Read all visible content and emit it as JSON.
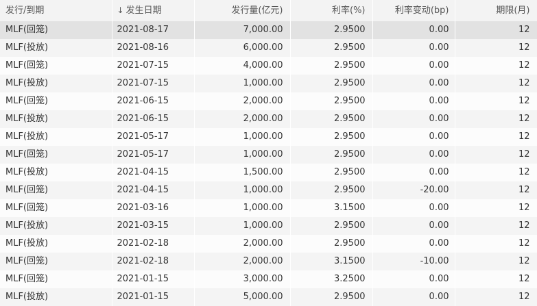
{
  "headers": {
    "type": "发行/到期",
    "sort_icon": "↓",
    "date": "发生日期",
    "amount": "发行量(亿元)",
    "rate": "利率(%)",
    "change": "利率变动(bp)",
    "term": "期限(月)"
  },
  "rows": [
    {
      "type": "MLF(回笼)",
      "date": "2021-08-17",
      "amount": "7,000.00",
      "rate": "2.9500",
      "change": "0.00",
      "term": "12"
    },
    {
      "type": "MLF(投放)",
      "date": "2021-08-16",
      "amount": "6,000.00",
      "rate": "2.9500",
      "change": "0.00",
      "term": "12"
    },
    {
      "type": "MLF(回笼)",
      "date": "2021-07-15",
      "amount": "4,000.00",
      "rate": "2.9500",
      "change": "0.00",
      "term": "12"
    },
    {
      "type": "MLF(投放)",
      "date": "2021-07-15",
      "amount": "1,000.00",
      "rate": "2.9500",
      "change": "0.00",
      "term": "12"
    },
    {
      "type": "MLF(回笼)",
      "date": "2021-06-15",
      "amount": "2,000.00",
      "rate": "2.9500",
      "change": "0.00",
      "term": "12"
    },
    {
      "type": "MLF(投放)",
      "date": "2021-06-15",
      "amount": "2,000.00",
      "rate": "2.9500",
      "change": "0.00",
      "term": "12"
    },
    {
      "type": "MLF(投放)",
      "date": "2021-05-17",
      "amount": "1,000.00",
      "rate": "2.9500",
      "change": "0.00",
      "term": "12"
    },
    {
      "type": "MLF(回笼)",
      "date": "2021-05-17",
      "amount": "1,000.00",
      "rate": "2.9500",
      "change": "0.00",
      "term": "12"
    },
    {
      "type": "MLF(投放)",
      "date": "2021-04-15",
      "amount": "1,500.00",
      "rate": "2.9500",
      "change": "0.00",
      "term": "12"
    },
    {
      "type": "MLF(回笼)",
      "date": "2021-04-15",
      "amount": "1,000.00",
      "rate": "2.9500",
      "change": "-20.00",
      "term": "12"
    },
    {
      "type": "MLF(回笼)",
      "date": "2021-03-16",
      "amount": "1,000.00",
      "rate": "3.1500",
      "change": "0.00",
      "term": "12"
    },
    {
      "type": "MLF(投放)",
      "date": "2021-03-15",
      "amount": "1,000.00",
      "rate": "2.9500",
      "change": "0.00",
      "term": "12"
    },
    {
      "type": "MLF(投放)",
      "date": "2021-02-18",
      "amount": "2,000.00",
      "rate": "2.9500",
      "change": "0.00",
      "term": "12"
    },
    {
      "type": "MLF(回笼)",
      "date": "2021-02-18",
      "amount": "2,000.00",
      "rate": "3.1500",
      "change": "-10.00",
      "term": "12"
    },
    {
      "type": "MLF(回笼)",
      "date": "2021-01-15",
      "amount": "3,000.00",
      "rate": "3.2500",
      "change": "0.00",
      "term": "12"
    },
    {
      "type": "MLF(投放)",
      "date": "2021-01-15",
      "amount": "5,000.00",
      "rate": "2.9500",
      "change": "0.00",
      "term": "12"
    }
  ],
  "selected_row_index": 0,
  "colors": {
    "header_bg": "#f3f3f3",
    "row_odd": "#fcfcfc",
    "row_even": "#f4f4f4",
    "row_selected": "#e2e2e2",
    "text": "#333333"
  }
}
